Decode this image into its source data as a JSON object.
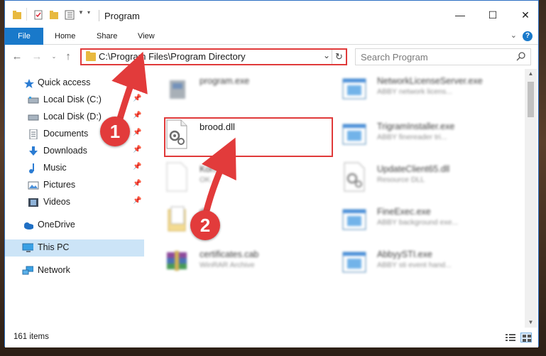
{
  "window": {
    "title": "Program",
    "controls": {
      "minimize": "—",
      "maximize": "☐",
      "close": "✕"
    }
  },
  "ribbon": {
    "tabs": [
      {
        "label": "File",
        "active": true
      },
      {
        "label": "Home"
      },
      {
        "label": "Share"
      },
      {
        "label": "View"
      }
    ],
    "help": "?"
  },
  "navigation": {
    "address": "C:\\Program Files\\Program Directory",
    "search_placeholder": "Search Program"
  },
  "sidebar": {
    "items": [
      {
        "label": "Quick access",
        "icon": "star-icon",
        "pinned": false
      },
      {
        "label": "Local Disk (C:)",
        "icon": "drive-icon",
        "pinned": true
      },
      {
        "label": "Local Disk (D:)",
        "icon": "drive-icon",
        "pinned": true
      },
      {
        "label": "Documents",
        "icon": "documents-icon",
        "pinned": true
      },
      {
        "label": "Downloads",
        "icon": "downloads-icon",
        "pinned": true
      },
      {
        "label": "Music",
        "icon": "music-icon",
        "pinned": true
      },
      {
        "label": "Pictures",
        "icon": "pictures-icon",
        "pinned": true
      },
      {
        "label": "Videos",
        "icon": "videos-icon",
        "pinned": true
      },
      {
        "label": "OneDrive",
        "icon": "onedrive-icon",
        "pinned": false
      },
      {
        "label": "This PC",
        "icon": "this-pc-icon",
        "selected": true
      },
      {
        "label": "Network",
        "icon": "network-icon",
        "pinned": false
      }
    ]
  },
  "files": [
    {
      "name": "program.exe",
      "desc": "",
      "icon": "exe-icon",
      "blurred": true
    },
    {
      "name": "NetworkLicenseServer.exe",
      "desc": "ABBY network licens...",
      "icon": "app-window-icon",
      "blurred": true
    },
    {
      "name": "brood.dll",
      "desc": "",
      "icon": "dll-gear-icon",
      "blurred": false
    },
    {
      "name": "TrigramInstaller.exe",
      "desc": "ABBY finereader tri...",
      "icon": "app-window-icon",
      "blurred": true
    },
    {
      "name": "Kon...jk",
      "desc": "OK...",
      "icon": "blank-file-icon",
      "blurred": true
    },
    {
      "name": "UpdateClient65.dll",
      "desc": "Resource DLL",
      "icon": "dll-gear-icon",
      "blurred": true
    },
    {
      "name": "d...",
      "desc": "",
      "icon": "folder-doc-icon",
      "blurred": true
    },
    {
      "name": "FineExec.exe",
      "desc": "ABBY background exe...",
      "icon": "app-window-icon",
      "blurred": true
    },
    {
      "name": "certificates.cab",
      "desc": "WinRAR Archive",
      "icon": "winrar-icon",
      "blurred": true
    },
    {
      "name": "AbbyySTI.exe",
      "desc": "ABBY sti event hand...",
      "icon": "app-window-icon",
      "blurred": true
    }
  ],
  "status": {
    "count": "161 items"
  },
  "annotations": {
    "step1": "1",
    "step2": "2"
  },
  "colors": {
    "accent": "#1979ca",
    "highlight": "#e03a3a",
    "selected": "#cce4f7"
  }
}
